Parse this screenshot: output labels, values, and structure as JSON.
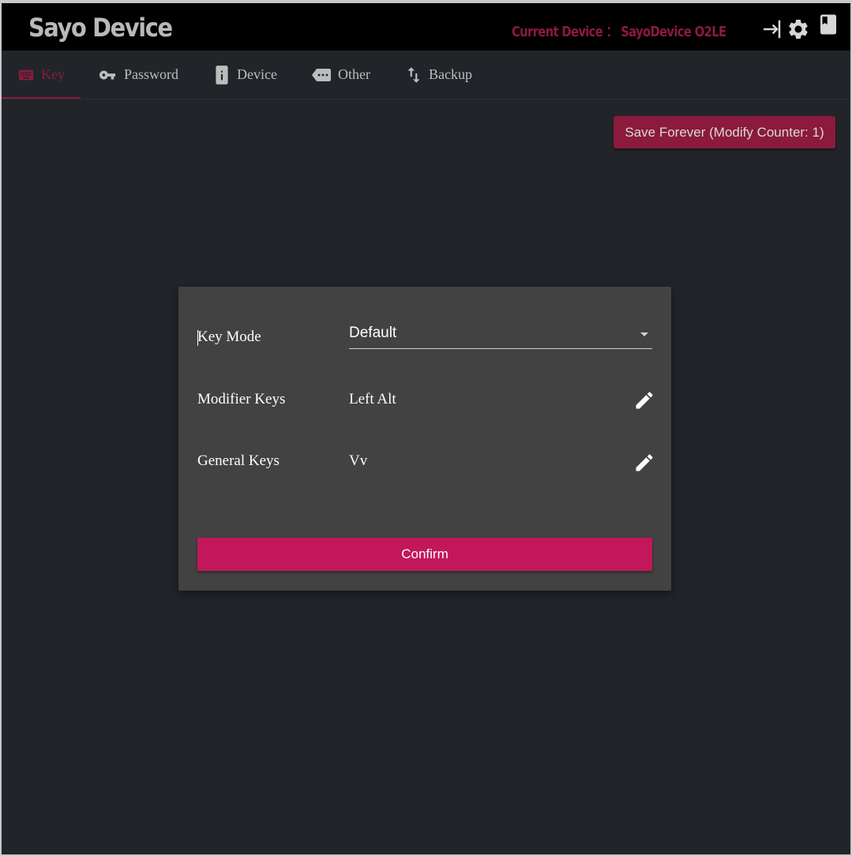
{
  "header": {
    "title": "Sayo Device",
    "current_device": "Current Device ： SayoDevice O2LE",
    "icons": [
      "login-icon",
      "gear-icon",
      "book-icon"
    ]
  },
  "tabs": [
    {
      "label": "Key",
      "icon": "keyboard-icon",
      "active": true
    },
    {
      "label": "Password",
      "icon": "key-icon",
      "active": false
    },
    {
      "label": "Device",
      "icon": "info-icon",
      "active": false
    },
    {
      "label": "Other",
      "icon": "more-icon",
      "active": false
    },
    {
      "label": "Backup",
      "icon": "swap-vertical-icon",
      "active": false
    }
  ],
  "toolbar": {
    "save_label": "Save Forever (Modify Counter: 1)"
  },
  "dialog": {
    "key_mode_label": "Key Mode",
    "key_mode_value": "Default",
    "modifier_label": "Modifier Keys",
    "modifier_value": "Left Alt",
    "general_label": "General Keys",
    "general_value": "Vv",
    "confirm_label": "Confirm"
  },
  "colors": {
    "accent": "#8b1a3c",
    "confirm": "#c2185b",
    "background": "#212529",
    "dialog": "#424242"
  }
}
